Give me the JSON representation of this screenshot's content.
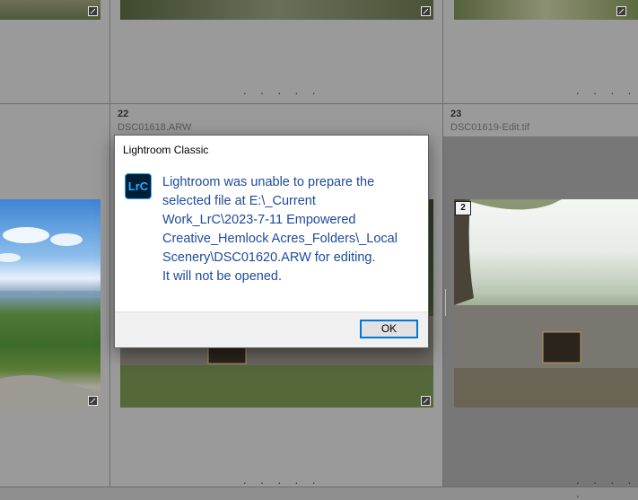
{
  "grid": {
    "cells": [
      {
        "index": "22",
        "filename": "DSC01618.ARW"
      },
      {
        "index": "23",
        "filename": "DSC01619-Edit.tif"
      }
    ],
    "dots": ". . . . .",
    "stack_count": "2"
  },
  "dialog": {
    "title": "Lightroom Classic",
    "icon_label": "LrC",
    "message": "Lightroom was unable to prepare the\nselected file at E:\\_Current\nWork_LrC\\2023-7-11 Empowered\nCreative_Hemlock Acres_Folders\\_Local\nScenery\\DSC01620.ARW for editing.\nIt will not be opened.",
    "ok_label": "OK"
  },
  "colors": {
    "grid_background": "#9a9a9a",
    "selected_cell": "#777777",
    "message_text": "#1d4a9e",
    "lrc_brand": "#31a8ff"
  }
}
